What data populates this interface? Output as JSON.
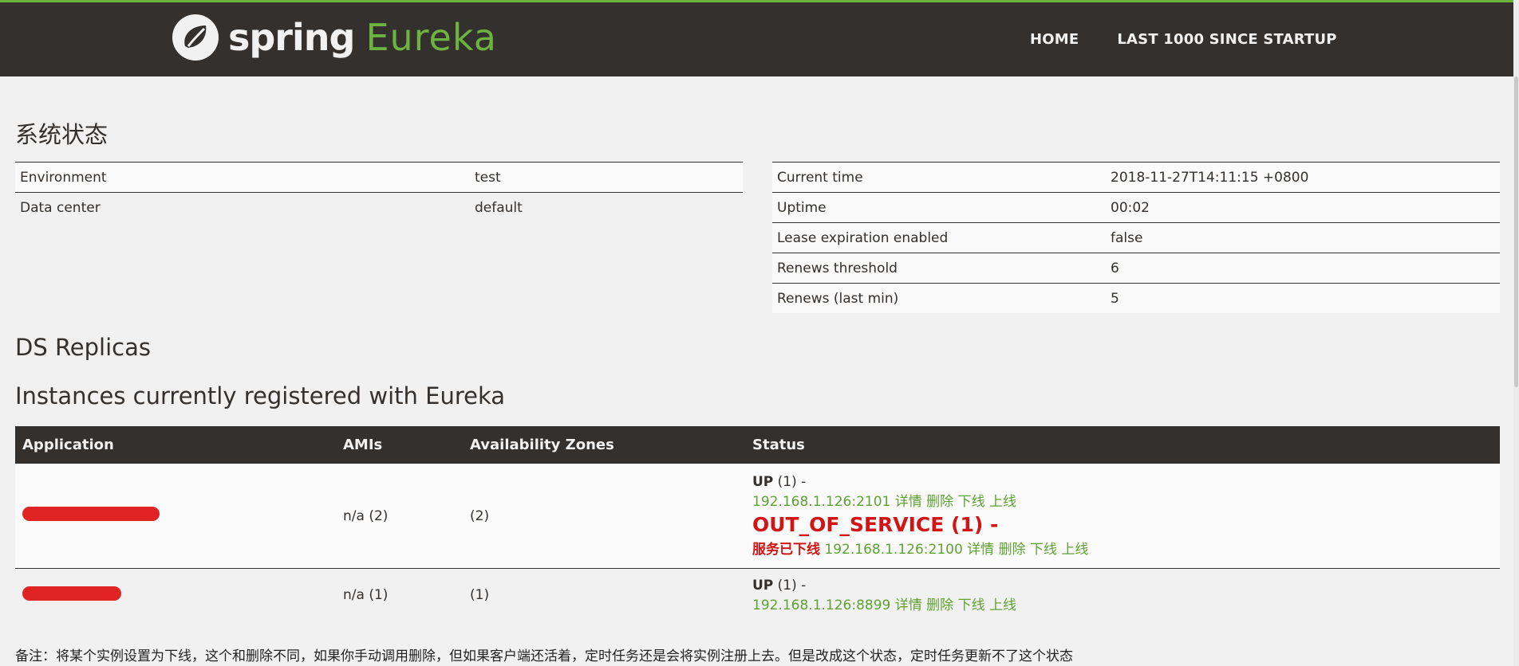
{
  "brand": {
    "word1": "spring",
    "word2": "Eureka"
  },
  "nav": {
    "home": "HOME",
    "last": "LAST 1000 SINCE STARTUP"
  },
  "system_status": {
    "heading": "系统状态",
    "left": [
      {
        "key": "Environment",
        "value": "test"
      },
      {
        "key": "Data center",
        "value": "default"
      }
    ],
    "right": [
      {
        "key": "Current time",
        "value": "2018-11-27T14:11:15 +0800"
      },
      {
        "key": "Uptime",
        "value": "00:02"
      },
      {
        "key": "Lease expiration enabled",
        "value": "false"
      },
      {
        "key": "Renews threshold",
        "value": "6"
      },
      {
        "key": "Renews (last min)",
        "value": "5"
      }
    ]
  },
  "replicas_heading": "DS Replicas",
  "instances": {
    "heading": "Instances currently registered with Eureka",
    "columns": [
      "Application",
      "AMIs",
      "Availability Zones",
      "Status"
    ],
    "rows": [
      {
        "amis": "n/a (2)",
        "zones": "(2)",
        "up_label": "UP",
        "up_count": "(1) -",
        "up_line": "192.168.1.126:2101 详情 删除 下线 上线",
        "oos_label": "OUT_OF_SERVICE (1) -",
        "oos_prefix": "服务已下线",
        "oos_line": "192.168.1.126:2100 详情 删除 下线 上线"
      },
      {
        "amis": "n/a (1)",
        "zones": "(1)",
        "up_label": "UP",
        "up_count": "(1) -",
        "up_line": "192.168.1.126:8899 详情 删除 下线 上线"
      }
    ]
  },
  "footnote": "备注：将某个实例设置为下线，这个和删除不同，如果你手动调用删除，但如果客户端还活着，定时任务还是会将实例注册上去。但是改成这个状态，定时任务更新不了这个状态",
  "colors": {
    "bar": "#34302d",
    "accent": "#6db33f",
    "link_green": "#5fa134",
    "alert_red": "#d31414"
  }
}
